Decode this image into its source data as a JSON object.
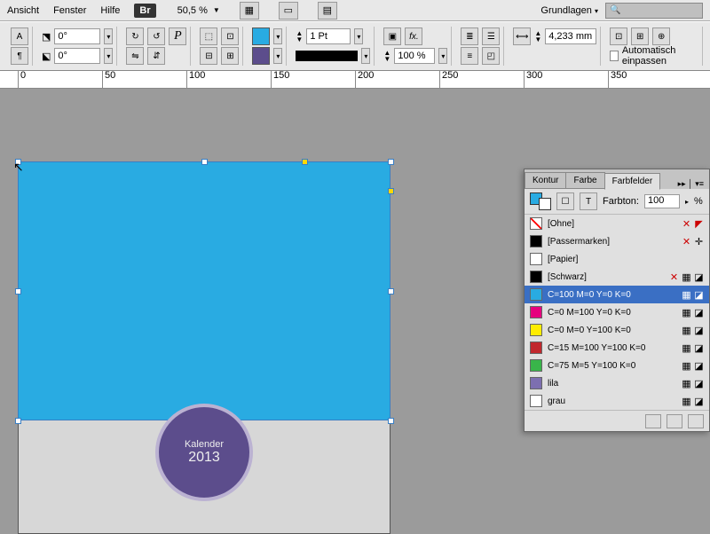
{
  "menu": {
    "ansicht": "Ansicht",
    "fenster": "Fenster",
    "hilfe": "Hilfe",
    "br": "Br",
    "zoom": "50,5 %",
    "workspace": "Grundlagen"
  },
  "controlbar": {
    "angle1": "0°",
    "angle2": "0°",
    "stroke_weight": "1 Pt",
    "opacity": "100 %",
    "width_val": "4,233 mm",
    "autofit": "Automatisch einpassen"
  },
  "ruler": {
    "ticks": [
      0,
      50,
      100,
      150,
      200,
      250,
      300,
      350
    ]
  },
  "artwork": {
    "title": "Kalender",
    "year": "2013"
  },
  "panel": {
    "tabs": {
      "kontur": "Kontur",
      "farbe": "Farbe",
      "farbfelder": "Farbfelder"
    },
    "tint_label": "Farbton:",
    "tint_val": "100",
    "tint_suffix": "%",
    "swatches": [
      {
        "name": "[Ohne]",
        "color": "none",
        "nonedit": true,
        "nonprint": true
      },
      {
        "name": "[Passermarken]",
        "color": "#000000",
        "nonedit": true,
        "reg": true
      },
      {
        "name": "[Papier]",
        "color": "#ffffff"
      },
      {
        "name": "[Schwarz]",
        "color": "#000000",
        "nonedit": true,
        "proc": true
      },
      {
        "name": "C=100 M=0 Y=0 K=0",
        "color": "#29abe2",
        "selected": true,
        "proc": true
      },
      {
        "name": "C=0 M=100 Y=0 K=0",
        "color": "#e6007e",
        "proc": true
      },
      {
        "name": "C=0 M=0 Y=100 K=0",
        "color": "#ffed00",
        "proc": true
      },
      {
        "name": "C=15 M=100 Y=100 K=0",
        "color": "#c1272d",
        "proc": true
      },
      {
        "name": "C=75 M=5 Y=100 K=0",
        "color": "#39b54a",
        "proc": true
      },
      {
        "name": "lila",
        "color": "#7d6fb0",
        "proc": true
      },
      {
        "name": "grau",
        "color": "#ffffff",
        "proc": true
      }
    ]
  }
}
